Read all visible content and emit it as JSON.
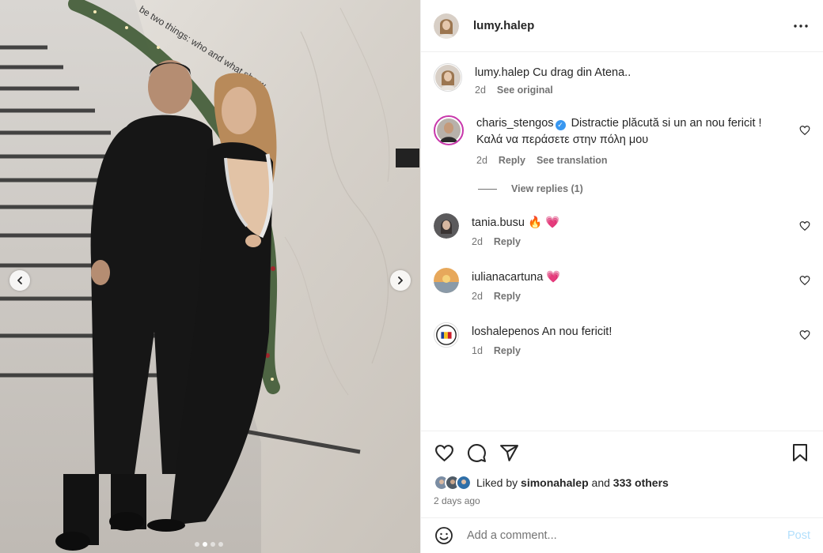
{
  "photo": {
    "wall_text": "be two things: who and what she w",
    "carousel_count": 4,
    "carousel_active": 1
  },
  "post": {
    "author": "lumy.halep",
    "caption_user": "lumy.halep",
    "caption_text": "Cu drag din Atena..",
    "caption_time": "2d",
    "see_original": "See original"
  },
  "comments": [
    {
      "user": "charis_stengos",
      "verified": true,
      "text": "Distractie plăcută si un an nou fericit ! Καλά να περάσετε στην πόλη μου",
      "time": "2d",
      "reply": "Reply",
      "translation": "See translation",
      "view_replies": "View replies (1)"
    },
    {
      "user": "tania.busu",
      "text": "🔥 💗",
      "time": "2d",
      "reply": "Reply"
    },
    {
      "user": "iulianacartuna",
      "text": "💗",
      "time": "2d",
      "reply": "Reply"
    },
    {
      "user": "loshalepenos",
      "text": "An nou fericit!",
      "time": "1d",
      "reply": "Reply"
    }
  ],
  "likes": {
    "prefix": "Liked by",
    "user": "simonahalep",
    "connector": "and",
    "others": "333 others",
    "time_ago": "2 days ago"
  },
  "composer": {
    "placeholder": "Add a comment...",
    "post_label": "Post"
  },
  "colors": {
    "text": "#262626",
    "secondary": "#737373",
    "post_disabled": "#b2dffc",
    "verified": "#3897f0",
    "heart": "#ed4956"
  },
  "icons": [
    "more-icon",
    "heart-icon",
    "comment-icon",
    "share-icon",
    "bookmark-icon",
    "emoji-icon",
    "chevron-left-icon",
    "chevron-right-icon",
    "verified-icon"
  ]
}
